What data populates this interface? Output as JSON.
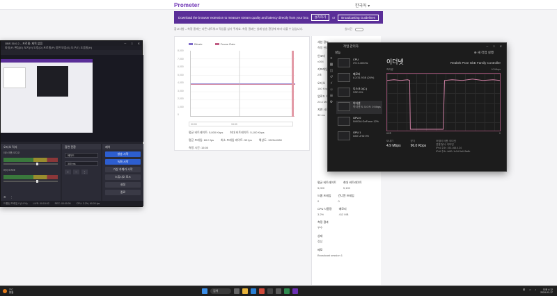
{
  "header": {
    "logo": "Prometer",
    "lang": "한국어 ▾"
  },
  "banner": {
    "message": "Download the browser extension to measure stream quality and latency directly from your broadcasting software",
    "button1": "설치하기",
    "or": "or",
    "button2": "Broadcasting Guidelines"
  },
  "notice": "참고사항 – 측정 중에는 다른 네트워크 작업을 삼가 주세요. 측정 결과는 실제 방송 환경에 따라 다를 수 있습니다.",
  "toggle_label": "실시간",
  "chart": {
    "legend": [
      "Bitrate",
      "Frame Rate"
    ],
    "ylabels": [
      "8,000",
      "7,000",
      "6,000",
      "5,000",
      "4,000",
      "3,000",
      "2,000",
      "1,000",
      "0"
    ],
    "range_left": "00:00",
    "range_right": "15:00",
    "meta": [
      [
        "평균 비트레이트: 5,000 Kbps",
        "최대 비트레이트: 5,100 Kbps"
      ],
      [
        "평균 프레임: 60.0 fps",
        "최소 프레임 레이트: 59 fps",
        "해상도: 1920x1080"
      ],
      [
        "측정 시간: 15:00"
      ]
    ]
  },
  "chart_data": {
    "type": "line",
    "series": [
      {
        "name": "Bitrate",
        "values": [
          4,
          4,
          4,
          4,
          4,
          4,
          4,
          4,
          4,
          4
        ]
      },
      {
        "name": "Frame Rate",
        "values": [
          4,
          4,
          4,
          4,
          4,
          4,
          4,
          4,
          4,
          4
        ]
      }
    ],
    "colors": {
      "bitrate": "#7e6cc9",
      "framerate": "#c05c83"
    }
  },
  "side_panel": {
    "items": [
      {
        "k": "세션 정보",
        "v": "측정 완료"
      },
      {
        "k": "인코더",
        "v": "x264"
      },
      {
        "k": "키프레임 간격",
        "v": "2초"
      },
      {
        "k": "오디오",
        "v": "160 Kbps"
      },
      {
        "k": "업로드 속도",
        "v": "20.4 Mbps"
      },
      {
        "k": "지연 시간",
        "v": "32 ms"
      }
    ],
    "pairs": [
      [
        {
          "k": "평균 비트레이트",
          "v": "5,000"
        },
        {
          "k": "최대 비트레이트",
          "v": "5,100"
        }
      ],
      [
        {
          "k": "드롭 프레임",
          "v": "0"
        },
        {
          "k": "건너뛴 프레임",
          "v": "0"
        }
      ],
      [
        {
          "k": "CPU 사용량",
          "v": "3.2%"
        },
        {
          "k": "메모리",
          "v": "412 MB"
        }
      ]
    ],
    "tail": [
      {
        "k": "측정 결과",
        "v": "우수"
      },
      {
        "k": "상태",
        "v": "정상"
      },
      {
        "k": "메모",
        "v": "Broadcast session 1"
      }
    ]
  },
  "obs": {
    "title": "OBS 30.0.2 – 프로필: 제목 없음",
    "menu": "파일(F)  편집(E)  보기(V)  도킹(D)  프로필(P)  장면 모음(S)  도구(T)  도움말(H)",
    "mixer_title": "오디오 믹서",
    "track1": "데스크톱 오디오",
    "track2": "마이크/보조",
    "trans_title": "장면 전환",
    "trans_value": "페이드",
    "trans_duration": "300 ms",
    "ctrls_title": "제어",
    "ctrls": [
      "방송 시작",
      "녹화 시작",
      "가상 카메라 시작",
      "스튜디오 모드",
      "설정",
      "종료"
    ],
    "status": [
      "드롭된 프레임 0 (0.0%)",
      "LIVE: 00:15:02",
      "REC: 00:00:00",
      "CPU: 3.2%, 60.00 fps"
    ]
  },
  "taskman": {
    "title": "작업 관리자",
    "section": "성능",
    "run_task": "새 작업 실행",
    "items": [
      {
        "name": "CPU",
        "sub": "3% 3.40GHz"
      },
      {
        "name": "메모리",
        "sub": "8.2/31.9GB (26%)"
      },
      {
        "name": "디스크 0(C:)",
        "sub": "SSD 0%"
      },
      {
        "name": "이더넷",
        "sub": "이더넷 S: 5.0 R: 0 Mbps"
      },
      {
        "name": "GPU 0",
        "sub": "NVIDIA GeForce 12%"
      },
      {
        "name": "GPU 1",
        "sub": "Intel UHD 0%"
      }
    ],
    "heading": "이더넷",
    "device": "Realtek PCIe GbE Family Controller",
    "sub_left": "처리량",
    "sub_right": "10 Mbps",
    "axis_left": "60초",
    "axis_right": "0",
    "stats": [
      {
        "k": "보내기",
        "v": "4.9 Mbps"
      },
      {
        "k": "받기",
        "v": "96.0 Kbps"
      }
    ],
    "props": [
      "어댑터 이름: 이더넷",
      "연결 형식: 이더넷",
      "IPv4 주소: 192.168.0.24",
      "IPv6 주소: fe80::1c2d:3e4f:5a6b"
    ],
    "graph_color": "#d483a8"
  },
  "taskbar": {
    "weather_temp": "3°C",
    "weather_desc": "맑음",
    "search": "검색",
    "time": "오후 4:12",
    "date": "2024-01-17",
    "lang": "한"
  }
}
